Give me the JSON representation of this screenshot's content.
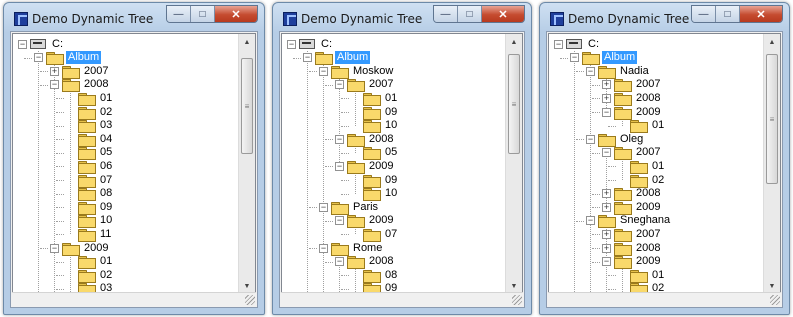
{
  "windows": [
    {
      "title": "Demo Dynamic Tree",
      "nodes": [
        {
          "label": "C:",
          "depth": 0,
          "icon": "drive",
          "expander": "minus"
        },
        {
          "label": "Album",
          "depth": 1,
          "icon": "folder-open",
          "expander": "minus",
          "selected": true
        },
        {
          "label": "2007",
          "depth": 2,
          "icon": "folder",
          "expander": "plus"
        },
        {
          "label": "2008",
          "depth": 2,
          "icon": "folder",
          "expander": "minus"
        },
        {
          "label": "01",
          "depth": 3,
          "icon": "folder",
          "expander": "none"
        },
        {
          "label": "02",
          "depth": 3,
          "icon": "folder",
          "expander": "none"
        },
        {
          "label": "03",
          "depth": 3,
          "icon": "folder",
          "expander": "none"
        },
        {
          "label": "04",
          "depth": 3,
          "icon": "folder",
          "expander": "none"
        },
        {
          "label": "05",
          "depth": 3,
          "icon": "folder",
          "expander": "none"
        },
        {
          "label": "06",
          "depth": 3,
          "icon": "folder",
          "expander": "none"
        },
        {
          "label": "07",
          "depth": 3,
          "icon": "folder",
          "expander": "none"
        },
        {
          "label": "08",
          "depth": 3,
          "icon": "folder",
          "expander": "none"
        },
        {
          "label": "09",
          "depth": 3,
          "icon": "folder",
          "expander": "none"
        },
        {
          "label": "10",
          "depth": 3,
          "icon": "folder",
          "expander": "none"
        },
        {
          "label": "11",
          "depth": 3,
          "icon": "folder",
          "expander": "none"
        },
        {
          "label": "2009",
          "depth": 2,
          "icon": "folder",
          "expander": "minus"
        },
        {
          "label": "01",
          "depth": 3,
          "icon": "folder",
          "expander": "none"
        },
        {
          "label": "02",
          "depth": 3,
          "icon": "folder",
          "expander": "none"
        },
        {
          "label": "03",
          "depth": 3,
          "icon": "folder",
          "expander": "none"
        }
      ]
    },
    {
      "title": "Demo Dynamic Tree",
      "nodes": [
        {
          "label": "C:",
          "depth": 0,
          "icon": "drive",
          "expander": "minus"
        },
        {
          "label": "Album",
          "depth": 1,
          "icon": "folder-open",
          "expander": "minus",
          "selected": true
        },
        {
          "label": "Moskow",
          "depth": 2,
          "icon": "folder",
          "expander": "minus"
        },
        {
          "label": "2007",
          "depth": 3,
          "icon": "folder",
          "expander": "minus"
        },
        {
          "label": "01",
          "depth": 4,
          "icon": "folder",
          "expander": "none"
        },
        {
          "label": "09",
          "depth": 4,
          "icon": "folder",
          "expander": "none"
        },
        {
          "label": "10",
          "depth": 4,
          "icon": "folder",
          "expander": "none"
        },
        {
          "label": "2008",
          "depth": 3,
          "icon": "folder",
          "expander": "minus"
        },
        {
          "label": "05",
          "depth": 4,
          "icon": "folder",
          "expander": "none"
        },
        {
          "label": "2009",
          "depth": 3,
          "icon": "folder",
          "expander": "minus"
        },
        {
          "label": "09",
          "depth": 4,
          "icon": "folder",
          "expander": "none"
        },
        {
          "label": "10",
          "depth": 4,
          "icon": "folder",
          "expander": "none"
        },
        {
          "label": "Paris",
          "depth": 2,
          "icon": "folder",
          "expander": "minus"
        },
        {
          "label": "2009",
          "depth": 3,
          "icon": "folder",
          "expander": "minus"
        },
        {
          "label": "07",
          "depth": 4,
          "icon": "folder",
          "expander": "none"
        },
        {
          "label": "Rome",
          "depth": 2,
          "icon": "folder",
          "expander": "minus"
        },
        {
          "label": "2008",
          "depth": 3,
          "icon": "folder",
          "expander": "minus"
        },
        {
          "label": "08",
          "depth": 4,
          "icon": "folder",
          "expander": "none"
        },
        {
          "label": "09",
          "depth": 4,
          "icon": "folder",
          "expander": "none"
        }
      ]
    },
    {
      "title": "Demo Dynamic Tree",
      "nodes": [
        {
          "label": "C:",
          "depth": 0,
          "icon": "drive",
          "expander": "minus"
        },
        {
          "label": "Album",
          "depth": 1,
          "icon": "folder-open",
          "expander": "minus",
          "selected": true
        },
        {
          "label": "Nadia",
          "depth": 2,
          "icon": "folder",
          "expander": "minus"
        },
        {
          "label": "2007",
          "depth": 3,
          "icon": "folder",
          "expander": "plus"
        },
        {
          "label": "2008",
          "depth": 3,
          "icon": "folder",
          "expander": "plus"
        },
        {
          "label": "2009",
          "depth": 3,
          "icon": "folder",
          "expander": "minus"
        },
        {
          "label": "01",
          "depth": 4,
          "icon": "folder",
          "expander": "none"
        },
        {
          "label": "Oleg",
          "depth": 2,
          "icon": "folder",
          "expander": "minus"
        },
        {
          "label": "2007",
          "depth": 3,
          "icon": "folder",
          "expander": "minus"
        },
        {
          "label": "01",
          "depth": 4,
          "icon": "folder",
          "expander": "none"
        },
        {
          "label": "02",
          "depth": 4,
          "icon": "folder",
          "expander": "none"
        },
        {
          "label": "2008",
          "depth": 3,
          "icon": "folder",
          "expander": "plus"
        },
        {
          "label": "2009",
          "depth": 3,
          "icon": "folder",
          "expander": "plus"
        },
        {
          "label": "Sneghana",
          "depth": 2,
          "icon": "folder",
          "expander": "minus"
        },
        {
          "label": "2007",
          "depth": 3,
          "icon": "folder",
          "expander": "plus"
        },
        {
          "label": "2008",
          "depth": 3,
          "icon": "folder",
          "expander": "plus"
        },
        {
          "label": "2009",
          "depth": 3,
          "icon": "folder",
          "expander": "minus"
        },
        {
          "label": "01",
          "depth": 4,
          "icon": "folder",
          "expander": "none"
        },
        {
          "label": "02",
          "depth": 4,
          "icon": "folder",
          "expander": "none"
        }
      ]
    }
  ],
  "colors": {
    "selection": "#3399ff",
    "folder": "#f9d96b",
    "close_button": "#c54b2f"
  }
}
